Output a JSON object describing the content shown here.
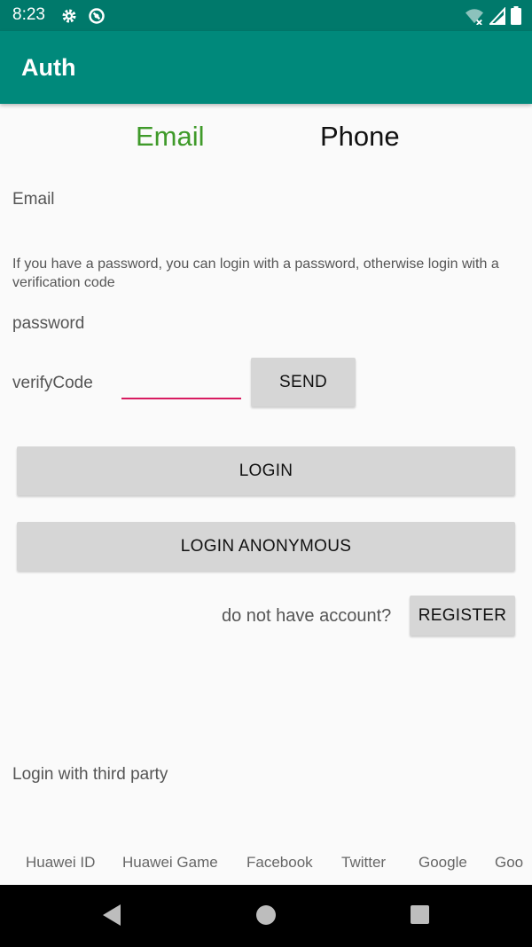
{
  "status_bar": {
    "time": "8:23",
    "icons": [
      "gear-icon",
      "sync-icon",
      "wifi-icon",
      "signal-icon",
      "battery-icon"
    ]
  },
  "app_bar": {
    "title": "Auth"
  },
  "tabs": [
    {
      "label": "Email",
      "selected": true,
      "color": "#3f9a2a"
    },
    {
      "label": "Phone",
      "selected": false,
      "color": "#111111"
    }
  ],
  "form": {
    "email_label": "Email",
    "hint": "If you have a password, you can login with a password, otherwise login with a verification code",
    "password_label": "password",
    "verify_label": "verifyCode",
    "verify_value": "",
    "send_label": "SEND",
    "login_label": "LOGIN",
    "anonymous_label": "LOGIN ANONYMOUS",
    "no_account_text": "do not have account?",
    "register_label": "REGISTER"
  },
  "third_party": {
    "label": "Login with third party",
    "providers": [
      "Huawei ID",
      "Huawei Game",
      "Facebook",
      "Twitter",
      "Google",
      "Goo"
    ]
  },
  "colors": {
    "primary": "#00897b",
    "primary_dark": "#00796b",
    "accent": "#d81b60"
  }
}
